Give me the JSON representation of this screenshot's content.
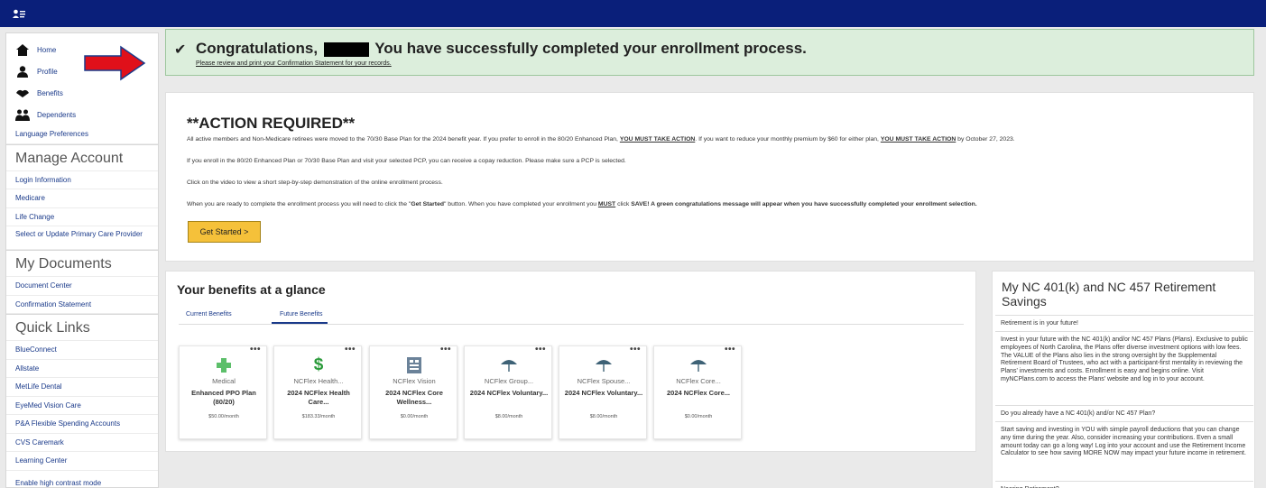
{
  "sidebar": {
    "nav": [
      {
        "label": "Home",
        "icon": "home-icon"
      },
      {
        "label": "Profile",
        "icon": "profile-icon"
      },
      {
        "label": "Benefits",
        "icon": "benefits-icon"
      },
      {
        "label": "Dependents",
        "icon": "dependents-icon"
      }
    ],
    "language": "Language Preferences",
    "manage_heading": "Manage Account",
    "manage_links": [
      "Login Information",
      "Medicare",
      "Life Change",
      "Select or Update Primary Care Provider"
    ],
    "documents_heading": "My Documents",
    "documents_links": [
      "Document Center",
      "Confirmation Statement"
    ],
    "quick_heading": "Quick Links",
    "quick_links": [
      "BlueConnect",
      "Allstate",
      "MetLife Dental",
      "EyeMed Vision Care",
      "P&A Flexible Spending Accounts",
      "CVS Caremark",
      "Learning Center"
    ],
    "contrast": "Enable high contrast mode"
  },
  "congrats": {
    "prefix": "Congratulations,",
    "suffix": "You have successfully completed your enrollment process.",
    "link": "Please review and print your Confirmation Statement for your records."
  },
  "action": {
    "title": "**ACTION REQUIRED**",
    "p1_a": "All active members and Non-Medicare retirees were moved to the 70/30 Base Plan for the 2024 benefit year. If you prefer to enroll in the 80/20 Enhanced Plan, ",
    "p1_b": "YOU MUST TAKE ACTION",
    "p1_c": ". If you want to reduce your monthly premium by $60 for either plan, ",
    "p1_d": "YOU MUST TAKE ACTION",
    "p1_e": " by October 27, 2023.",
    "p2": "If you enroll in the 80/20 Enhanced Plan or 70/30 Base Plan and visit your selected PCP, you can receive a copay reduction. Please make sure a PCP is selected.",
    "p3": "Click on the video to view a short step-by-step demonstration of the online enrollment process.",
    "p4_a": "When you are ready to complete the enrollment process you will need to click the \"",
    "p4_b": "Get Started",
    "p4_c": "\" button. When you have completed your enrollment you ",
    "p4_d": "MUST",
    "p4_e": " click ",
    "p4_f": "SAVE! A green congratulations message will appear when you have successfully completed your enrollment selection.",
    "button": "Get Started >"
  },
  "glance": {
    "title": "Your benefits at a glance",
    "tabs": [
      "Current Benefits",
      "Future Benefits"
    ],
    "cards": [
      {
        "category": "Medical",
        "name": "Enhanced PPO Plan (80/20)",
        "price": "$50.00/month",
        "icon": "medical-cross-icon"
      },
      {
        "category": "NCFlex Health...",
        "name": "2024 NCFlex Health Care...",
        "price": "$183.33/month",
        "icon": "dollar-icon"
      },
      {
        "category": "NCFlex Vision",
        "name": "2024 NCFlex Core Wellness...",
        "price": "$0.00/month",
        "icon": "vision-icon"
      },
      {
        "category": "NCFlex Group...",
        "name": "2024 NCFlex Voluntary...",
        "price": "$8.00/month",
        "icon": "umbrella-icon"
      },
      {
        "category": "NCFlex Spouse...",
        "name": "2024 NCFlex Voluntary...",
        "price": "$8.00/month",
        "icon": "umbrella-icon"
      },
      {
        "category": "NCFlex Core...",
        "name": "2024 NCFlex Core...",
        "price": "$0.00/month",
        "icon": "umbrella-icon"
      }
    ]
  },
  "retirement": {
    "title": "My NC 401(k) and NC 457 Retirement Savings",
    "s1": "Retirement is in your future!",
    "s2": "Invest in your future with the NC 401(k) and/or NC 457 Plans (Plans). Exclusive to public employees of North Carolina, the Plans offer diverse investment options with low fees. The VALUE of the Plans also lies in the strong oversight by the Supplemental Retirement Board of Trustees, who act with a participant-first mentality in reviewing the Plans' investments and costs. Enrollment is easy and begins online. Visit myNCPlans.com to access the Plans' website and log in to your account.",
    "s3": "Do you already have a NC 401(k) and/or NC 457 Plan?",
    "s4": "Start saving and investing in YOU with simple payroll deductions that you can change any time during the year. Also, consider increasing your contributions. Even a small amount today can go a long way! Log into your account and use the Retirement Income Calculator to see how saving MORE NOW may impact your future income in retirement.",
    "s5": "Nearing Retirement?"
  },
  "colors": {
    "topbar": "#0a1f7a",
    "success_bg": "#dceedc",
    "button": "#f5c13a",
    "link": "#1a3a8a",
    "arrow": "#e0101a"
  }
}
